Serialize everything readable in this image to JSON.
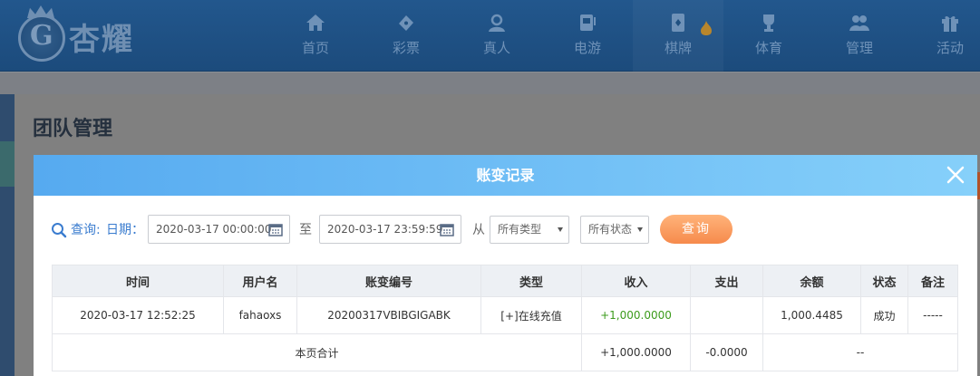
{
  "brand": {
    "logo_text": "杏耀",
    "emblem_letter": "G"
  },
  "nav": [
    {
      "label": "首页",
      "icon": "home-icon"
    },
    {
      "label": "彩票",
      "icon": "ticket-icon"
    },
    {
      "label": "真人",
      "icon": "live-dealer-icon"
    },
    {
      "label": "电游",
      "icon": "slot-machine-icon"
    },
    {
      "label": "棋牌",
      "icon": "cards-icon"
    },
    {
      "label": "体育",
      "icon": "trophy-icon"
    },
    {
      "label": "管理",
      "icon": "users-icon"
    },
    {
      "label": "活动",
      "icon": "gift-icon"
    }
  ],
  "page": {
    "title": "团队管理"
  },
  "modal": {
    "title": "账变记录",
    "filter": {
      "query_label": "查询:",
      "date_label": "日期：",
      "start_date": "2020-03-17 00:00:00",
      "to_label": "至",
      "end_date": "2020-03-17 23:59:59",
      "from_label": "从",
      "type_select": "所有类型",
      "status_select": "所有状态",
      "query_button": "查询"
    },
    "table": {
      "headers": [
        "时间",
        "用户名",
        "账变编号",
        "类型",
        "收入",
        "支出",
        "余额",
        "状态",
        "备注"
      ],
      "rows": [
        {
          "time": "2020-03-17 12:52:25",
          "username": "fahaoxs",
          "txn_id": "20200317VBIBGIGABK",
          "type": "[+]在线充值",
          "income": "+1,000.0000",
          "expense": "",
          "balance": "1,000.4485",
          "status": "成功",
          "remark": "-----"
        }
      ],
      "summary": {
        "label": "本页合计",
        "income": "+1,000.0000",
        "expense": "-0.0000",
        "balance": "--"
      }
    }
  },
  "colors": {
    "header_start": "#56aaf0",
    "header_end": "#86d0fa",
    "query_button": "#f68a4c",
    "income_green": "#3c9b1c",
    "label_blue": "#3a7ccf"
  }
}
